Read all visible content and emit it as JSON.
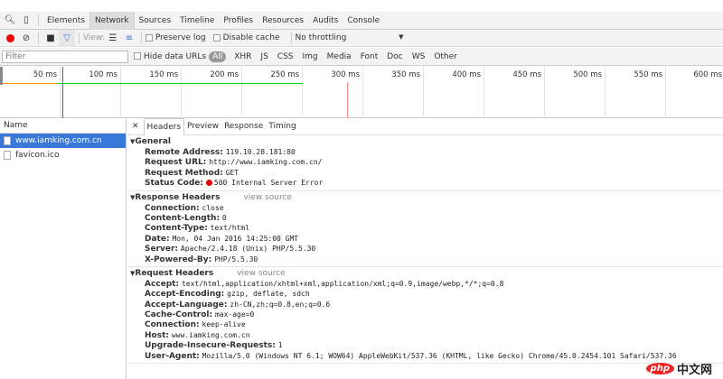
{
  "tabs": [
    "Elements",
    "Network",
    "Sources",
    "Timeline",
    "Profiles",
    "Resources",
    "Audits",
    "Console"
  ],
  "toolbar": {
    "view_label": "View:",
    "preserve_log": "Preserve log",
    "disable_cache": "Disable cache",
    "throttling": "No throttling"
  },
  "filter": {
    "placeholder": "Filter",
    "hide_data_urls": "Hide data URLs",
    "types": [
      "All",
      "XHR",
      "JS",
      "CSS",
      "Img",
      "Media",
      "Font",
      "Doc",
      "WS",
      "Other"
    ]
  },
  "timeline": {
    "ticks": [
      "50 ms",
      "100 ms",
      "150 ms",
      "200 ms",
      "250 ms",
      "300 ms",
      "350 ms",
      "400 ms",
      "450 ms",
      "500 ms",
      "550 ms",
      "600 ms"
    ]
  },
  "requests": {
    "header": "Name",
    "items": [
      "www.iamking.com.cn",
      "favicon.ico"
    ]
  },
  "details": {
    "tabs": [
      "Headers",
      "Preview",
      "Response",
      "Timing"
    ],
    "general": {
      "title": "General",
      "rows": [
        [
          "Remote Address:",
          "119.10.28.181:80"
        ],
        [
          "Request URL:",
          "http://www.iamking.com.cn/"
        ],
        [
          "Request Method:",
          "GET"
        ],
        [
          "Status Code:",
          "500 Internal Server Error"
        ]
      ]
    },
    "response": {
      "title": "Response Headers",
      "view_source": "view source",
      "rows": [
        [
          "Connection:",
          "close"
        ],
        [
          "Content-Length:",
          "0"
        ],
        [
          "Content-Type:",
          "text/html"
        ],
        [
          "Date:",
          "Mon, 04 Jan 2016 14:25:00 GMT"
        ],
        [
          "Server:",
          "Apache/2.4.18 (Unix) PHP/5.5.30"
        ],
        [
          "X-Powered-By:",
          "PHP/5.5.30"
        ]
      ]
    },
    "request": {
      "title": "Request Headers",
      "view_source": "view source",
      "rows": [
        [
          "Accept:",
          "text/html,application/xhtml+xml,application/xml;q=0.9,image/webp,*/*;q=0.8"
        ],
        [
          "Accept-Encoding:",
          "gzip, deflate, sdch"
        ],
        [
          "Accept-Language:",
          "zh-CN,zh;q=0.8,en;q=0.6"
        ],
        [
          "Cache-Control:",
          "max-age=0"
        ],
        [
          "Connection:",
          "keep-alive"
        ],
        [
          "Host:",
          "www.iamking.com.cn"
        ],
        [
          "Upgrade-Insecure-Requests:",
          "1"
        ],
        [
          "User-Agent:",
          "Mozilla/5.0 (Windows NT 6.1; WOW64) AppleWebKit/537.36 (KHTML, like Gecko) Chrome/45.0.2454.101 Safari/537.36"
        ]
      ]
    }
  },
  "watermark": {
    "logo": "php",
    "text": "中文网"
  }
}
